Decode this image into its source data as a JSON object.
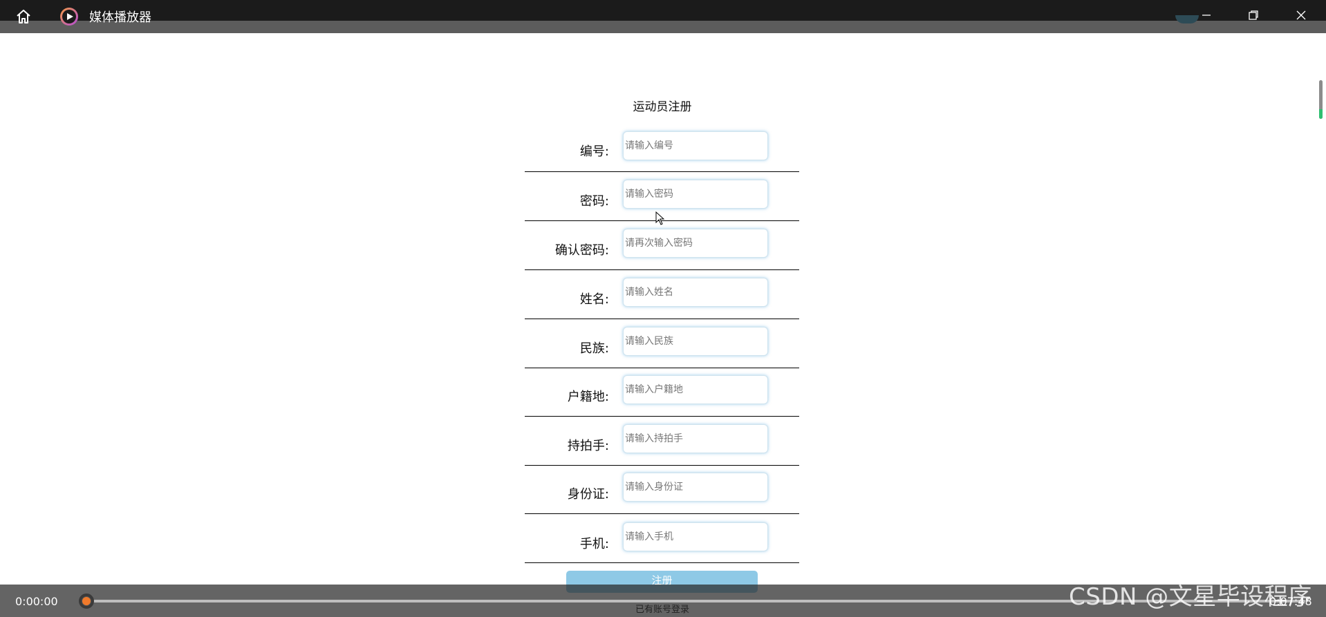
{
  "window": {
    "title": "媒体播放器"
  },
  "form": {
    "title": "运动员注册",
    "fields": [
      {
        "label": "编号:",
        "placeholder": "请输入编号"
      },
      {
        "label": "密码:",
        "placeholder": "请输入密码"
      },
      {
        "label": "确认密码:",
        "placeholder": "请再次输入密码"
      },
      {
        "label": "姓名:",
        "placeholder": "请输入姓名"
      },
      {
        "label": "民族:",
        "placeholder": "请输入民族"
      },
      {
        "label": "户籍地:",
        "placeholder": "请输入户籍地"
      },
      {
        "label": "持拍手:",
        "placeholder": "请输入持拍手"
      },
      {
        "label": "身份证:",
        "placeholder": "请输入身份证"
      },
      {
        "label": "手机:",
        "placeholder": "请输入手机"
      }
    ],
    "register_label": "注册",
    "login_link": "已有账号登录"
  },
  "player": {
    "current_time": "0:00:00",
    "total_time": "0:07:48",
    "progress_fraction": 0.0
  },
  "watermark": "CSDN @文星毕设程序",
  "colors": {
    "titlebar": "#1b1b1b",
    "register_button": "#8ec9e6",
    "seek_thumb": "#f07a2b",
    "input_glow": "#5aaadc"
  }
}
